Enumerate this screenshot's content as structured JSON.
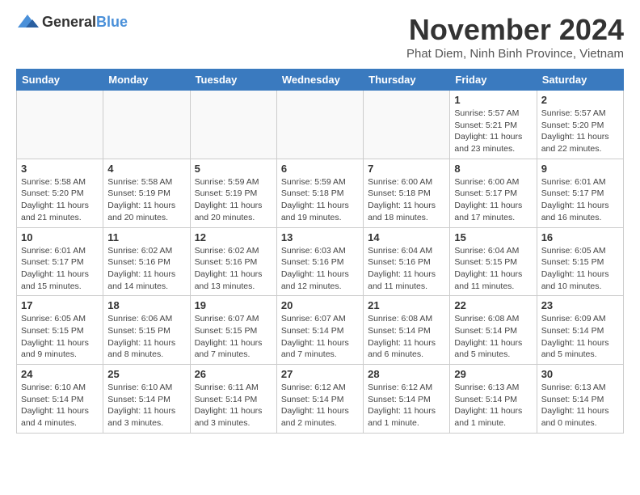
{
  "logo": {
    "general": "General",
    "blue": "Blue"
  },
  "header": {
    "month": "November 2024",
    "location": "Phat Diem, Ninh Binh Province, Vietnam"
  },
  "weekdays": [
    "Sunday",
    "Monday",
    "Tuesday",
    "Wednesday",
    "Thursday",
    "Friday",
    "Saturday"
  ],
  "weeks": [
    [
      {
        "day": "",
        "details": ""
      },
      {
        "day": "",
        "details": ""
      },
      {
        "day": "",
        "details": ""
      },
      {
        "day": "",
        "details": ""
      },
      {
        "day": "",
        "details": ""
      },
      {
        "day": "1",
        "details": "Sunrise: 5:57 AM\nSunset: 5:21 PM\nDaylight: 11 hours and 23 minutes."
      },
      {
        "day": "2",
        "details": "Sunrise: 5:57 AM\nSunset: 5:20 PM\nDaylight: 11 hours and 22 minutes."
      }
    ],
    [
      {
        "day": "3",
        "details": "Sunrise: 5:58 AM\nSunset: 5:20 PM\nDaylight: 11 hours and 21 minutes."
      },
      {
        "day": "4",
        "details": "Sunrise: 5:58 AM\nSunset: 5:19 PM\nDaylight: 11 hours and 20 minutes."
      },
      {
        "day": "5",
        "details": "Sunrise: 5:59 AM\nSunset: 5:19 PM\nDaylight: 11 hours and 20 minutes."
      },
      {
        "day": "6",
        "details": "Sunrise: 5:59 AM\nSunset: 5:18 PM\nDaylight: 11 hours and 19 minutes."
      },
      {
        "day": "7",
        "details": "Sunrise: 6:00 AM\nSunset: 5:18 PM\nDaylight: 11 hours and 18 minutes."
      },
      {
        "day": "8",
        "details": "Sunrise: 6:00 AM\nSunset: 5:17 PM\nDaylight: 11 hours and 17 minutes."
      },
      {
        "day": "9",
        "details": "Sunrise: 6:01 AM\nSunset: 5:17 PM\nDaylight: 11 hours and 16 minutes."
      }
    ],
    [
      {
        "day": "10",
        "details": "Sunrise: 6:01 AM\nSunset: 5:17 PM\nDaylight: 11 hours and 15 minutes."
      },
      {
        "day": "11",
        "details": "Sunrise: 6:02 AM\nSunset: 5:16 PM\nDaylight: 11 hours and 14 minutes."
      },
      {
        "day": "12",
        "details": "Sunrise: 6:02 AM\nSunset: 5:16 PM\nDaylight: 11 hours and 13 minutes."
      },
      {
        "day": "13",
        "details": "Sunrise: 6:03 AM\nSunset: 5:16 PM\nDaylight: 11 hours and 12 minutes."
      },
      {
        "day": "14",
        "details": "Sunrise: 6:04 AM\nSunset: 5:16 PM\nDaylight: 11 hours and 11 minutes."
      },
      {
        "day": "15",
        "details": "Sunrise: 6:04 AM\nSunset: 5:15 PM\nDaylight: 11 hours and 11 minutes."
      },
      {
        "day": "16",
        "details": "Sunrise: 6:05 AM\nSunset: 5:15 PM\nDaylight: 11 hours and 10 minutes."
      }
    ],
    [
      {
        "day": "17",
        "details": "Sunrise: 6:05 AM\nSunset: 5:15 PM\nDaylight: 11 hours and 9 minutes."
      },
      {
        "day": "18",
        "details": "Sunrise: 6:06 AM\nSunset: 5:15 PM\nDaylight: 11 hours and 8 minutes."
      },
      {
        "day": "19",
        "details": "Sunrise: 6:07 AM\nSunset: 5:15 PM\nDaylight: 11 hours and 7 minutes."
      },
      {
        "day": "20",
        "details": "Sunrise: 6:07 AM\nSunset: 5:14 PM\nDaylight: 11 hours and 7 minutes."
      },
      {
        "day": "21",
        "details": "Sunrise: 6:08 AM\nSunset: 5:14 PM\nDaylight: 11 hours and 6 minutes."
      },
      {
        "day": "22",
        "details": "Sunrise: 6:08 AM\nSunset: 5:14 PM\nDaylight: 11 hours and 5 minutes."
      },
      {
        "day": "23",
        "details": "Sunrise: 6:09 AM\nSunset: 5:14 PM\nDaylight: 11 hours and 5 minutes."
      }
    ],
    [
      {
        "day": "24",
        "details": "Sunrise: 6:10 AM\nSunset: 5:14 PM\nDaylight: 11 hours and 4 minutes."
      },
      {
        "day": "25",
        "details": "Sunrise: 6:10 AM\nSunset: 5:14 PM\nDaylight: 11 hours and 3 minutes."
      },
      {
        "day": "26",
        "details": "Sunrise: 6:11 AM\nSunset: 5:14 PM\nDaylight: 11 hours and 3 minutes."
      },
      {
        "day": "27",
        "details": "Sunrise: 6:12 AM\nSunset: 5:14 PM\nDaylight: 11 hours and 2 minutes."
      },
      {
        "day": "28",
        "details": "Sunrise: 6:12 AM\nSunset: 5:14 PM\nDaylight: 11 hours and 1 minute."
      },
      {
        "day": "29",
        "details": "Sunrise: 6:13 AM\nSunset: 5:14 PM\nDaylight: 11 hours and 1 minute."
      },
      {
        "day": "30",
        "details": "Sunrise: 6:13 AM\nSunset: 5:14 PM\nDaylight: 11 hours and 0 minutes."
      }
    ]
  ]
}
